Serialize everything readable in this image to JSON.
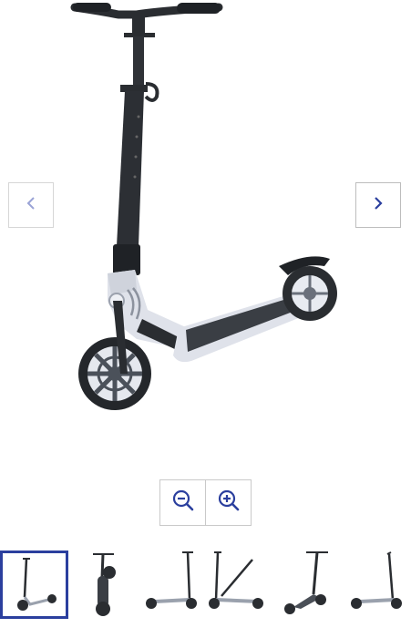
{
  "gallery": {
    "product_image_name": "scooter-main-image",
    "prev_icon": "chevron-left-icon",
    "next_icon": "chevron-right-icon",
    "zoom_out_icon": "zoom-out-icon",
    "zoom_in_icon": "zoom-in-icon",
    "active_thumbnail": 1,
    "thumbnail_count": 6
  },
  "colors": {
    "accent": "#2b3f9e",
    "nav_arrow_active": "#2b3f9e",
    "nav_arrow_inactive": "#9aa3d6",
    "scooter_frame": "#2a2d31",
    "scooter_deck_accent": "#dfe2ea"
  }
}
